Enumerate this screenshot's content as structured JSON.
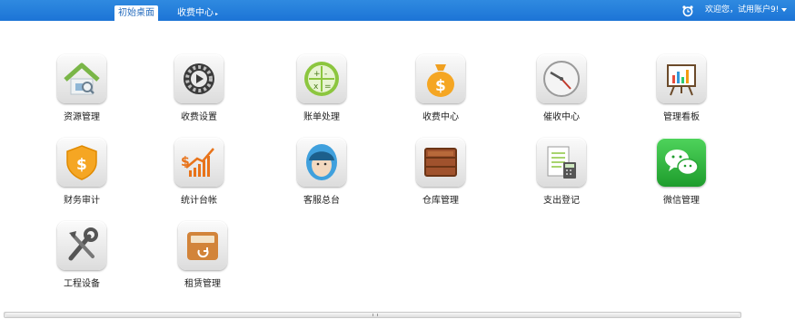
{
  "topbar": {
    "tabs": [
      {
        "label": "初始桌面",
        "active": true
      },
      {
        "label": "收费中心",
        "active": false
      }
    ],
    "alarm_icon": "alarm-clock-icon",
    "welcome_text": "欢迎您，试用账户9!"
  },
  "apps": [
    {
      "label": "资源管理",
      "icon": "house-icon"
    },
    {
      "label": "收费设置",
      "icon": "gear-icon"
    },
    {
      "label": "账单处理",
      "icon": "calculator-icon"
    },
    {
      "label": "收费中心",
      "icon": "money-bag-icon"
    },
    {
      "label": "催收中心",
      "icon": "clock-icon"
    },
    {
      "label": "管理看板",
      "icon": "easel-chart-icon"
    },
    {
      "label": "财务审计",
      "icon": "dollar-shield-icon"
    },
    {
      "label": "统计台帐",
      "icon": "growth-chart-icon"
    },
    {
      "label": "客服总台",
      "icon": "headset-agent-icon"
    },
    {
      "label": "仓库管理",
      "icon": "wooden-crate-icon"
    },
    {
      "label": "支出登记",
      "icon": "ledger-calculator-icon"
    },
    {
      "label": "微信管理",
      "icon": "wechat-icon"
    },
    {
      "label": "工程设备",
      "icon": "tools-icon"
    },
    {
      "label": "租赁管理",
      "icon": "storage-box-icon"
    }
  ],
  "colors": {
    "topbar": "#1c74d6",
    "active_tab_text": "#2a6fbf",
    "wechat_green": "#1e9c2c"
  }
}
